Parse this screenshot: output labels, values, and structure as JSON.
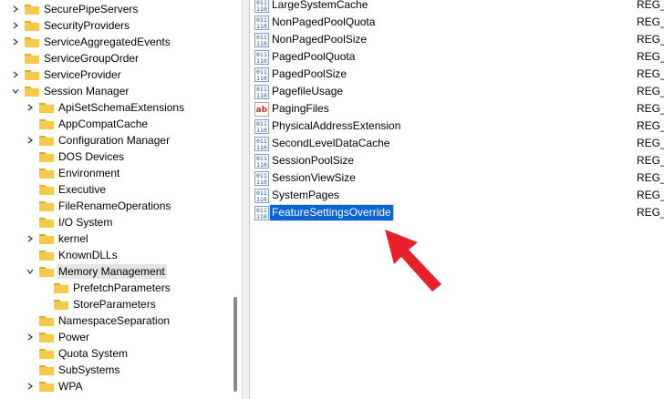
{
  "tree": {
    "items": [
      {
        "label": "SecurePipeServers",
        "expander": "collapsed",
        "depth": 1
      },
      {
        "label": "SecurityProviders",
        "expander": "collapsed",
        "depth": 1
      },
      {
        "label": "ServiceAggregatedEvents",
        "expander": "collapsed",
        "depth": 1
      },
      {
        "label": "ServiceGroupOrder",
        "expander": "none",
        "depth": 1
      },
      {
        "label": "ServiceProvider",
        "expander": "collapsed",
        "depth": 1
      },
      {
        "label": "Session Manager",
        "expander": "expanded",
        "depth": 1
      },
      {
        "label": "ApiSetSchemaExtensions",
        "expander": "collapsed",
        "depth": 2
      },
      {
        "label": "AppCompatCache",
        "expander": "none",
        "depth": 2
      },
      {
        "label": "Configuration Manager",
        "expander": "collapsed",
        "depth": 2
      },
      {
        "label": "DOS Devices",
        "expander": "none",
        "depth": 2
      },
      {
        "label": "Environment",
        "expander": "none",
        "depth": 2
      },
      {
        "label": "Executive",
        "expander": "none",
        "depth": 2
      },
      {
        "label": "FileRenameOperations",
        "expander": "none",
        "depth": 2
      },
      {
        "label": "I/O System",
        "expander": "none",
        "depth": 2
      },
      {
        "label": "kernel",
        "expander": "collapsed",
        "depth": 2
      },
      {
        "label": "KnownDLLs",
        "expander": "none",
        "depth": 2
      },
      {
        "label": "Memory Management",
        "expander": "expanded",
        "depth": 2,
        "selected": true
      },
      {
        "label": "PrefetchParameters",
        "expander": "none",
        "depth": 3
      },
      {
        "label": "StoreParameters",
        "expander": "none",
        "depth": 3
      },
      {
        "label": "NamespaceSeparation",
        "expander": "none",
        "depth": 2
      },
      {
        "label": "Power",
        "expander": "collapsed",
        "depth": 2
      },
      {
        "label": "Quota System",
        "expander": "none",
        "depth": 2
      },
      {
        "label": "SubSystems",
        "expander": "none",
        "depth": 2
      },
      {
        "label": "WPA",
        "expander": "collapsed",
        "depth": 2
      }
    ]
  },
  "values": {
    "rows": [
      {
        "name": "LargeSystemCache",
        "type": "REG_",
        "icon": "binary-value-icon"
      },
      {
        "name": "NonPagedPoolQuota",
        "type": "REG_",
        "icon": "binary-value-icon"
      },
      {
        "name": "NonPagedPoolSize",
        "type": "REG_",
        "icon": "binary-value-icon"
      },
      {
        "name": "PagedPoolQuota",
        "type": "REG_",
        "icon": "binary-value-icon"
      },
      {
        "name": "PagedPoolSize",
        "type": "REG_",
        "icon": "binary-value-icon"
      },
      {
        "name": "PagefileUsage",
        "type": "REG_",
        "icon": "binary-value-icon"
      },
      {
        "name": "PagingFiles",
        "type": "REG_",
        "icon": "string-value-icon"
      },
      {
        "name": "PhysicalAddressExtension",
        "type": "REG_",
        "icon": "binary-value-icon"
      },
      {
        "name": "SecondLevelDataCache",
        "type": "REG_",
        "icon": "binary-value-icon"
      },
      {
        "name": "SessionPoolSize",
        "type": "REG_",
        "icon": "binary-value-icon"
      },
      {
        "name": "SessionViewSize",
        "type": "REG_",
        "icon": "binary-value-icon"
      },
      {
        "name": "SystemPages",
        "type": "REG_",
        "icon": "binary-value-icon"
      },
      {
        "name": "FeatureSettingsOverride",
        "type": "REG_",
        "icon": "binary-value-icon",
        "selected": true
      }
    ]
  },
  "icons": {
    "string_glyph": "ab",
    "binary_glyph_top": "011",
    "binary_glyph_bottom": "110"
  },
  "colors": {
    "folder": "#f7c948",
    "selection": "#0a64d6",
    "arrow": "#e8202a",
    "tree_selection": "#e5e5e5"
  }
}
